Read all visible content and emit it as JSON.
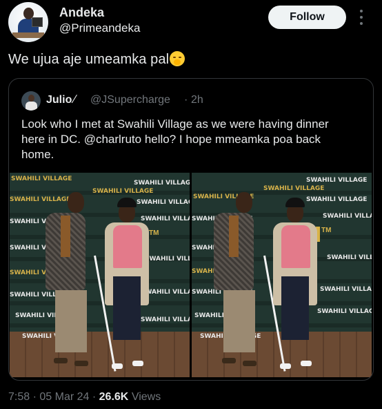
{
  "author": {
    "display_name": "Andeka",
    "handle": "@Primeandeka",
    "avatar": "profile-photo"
  },
  "actions": {
    "follow_label": "Follow",
    "more_icon": "more-vertical-icon"
  },
  "tweet": {
    "text": "We ujua aje umeamka pal",
    "emoji": "face-with-hand-over-mouth-emoji"
  },
  "quote": {
    "display_name": "Julio",
    "slash": "∕",
    "handle": "@JSupercharge",
    "separator": "·",
    "time": "2h",
    "lines": [
      "Look who I met at Swahili Village as we were having dinner",
      "here in DC. @charlruto hello? I hope mmeamka poa back",
      "home."
    ],
    "photos": [
      {
        "name": "photo-left",
        "backdrop_text": "SWAHILI VILLAGE"
      },
      {
        "name": "photo-right",
        "backdrop_text": "SWAHILI VILLAGE"
      }
    ]
  },
  "meta": {
    "time": "7:58",
    "sep1": "·",
    "date": "05 Mar 24",
    "sep2": "·",
    "views_count": "26.6K",
    "views_label": "Views"
  },
  "colors": {
    "background": "#000000",
    "text": "#e7e9ea",
    "secondary": "#71767b",
    "border": "#333639",
    "follow_bg": "#eff3f4"
  }
}
